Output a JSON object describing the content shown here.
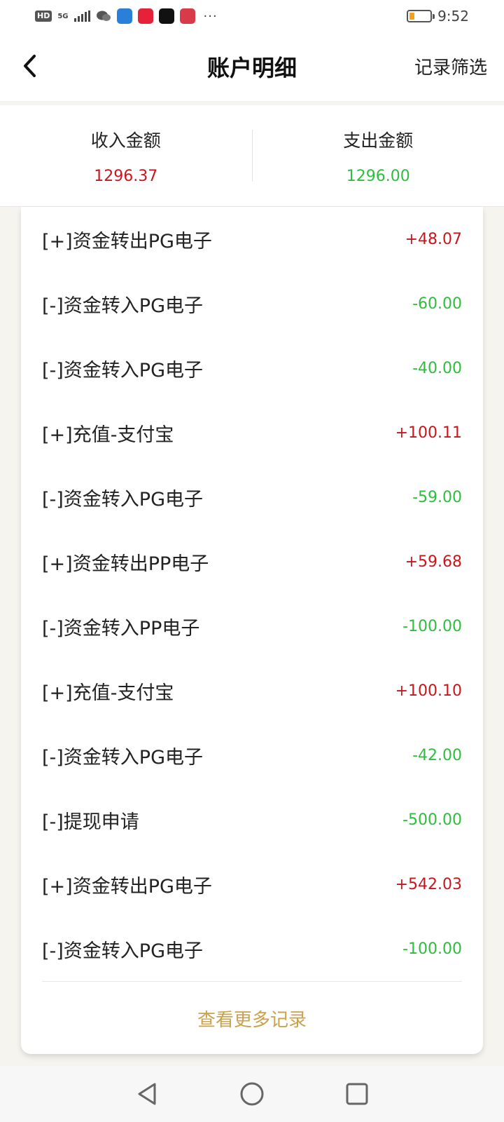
{
  "status_bar": {
    "left_badge": "HD",
    "network": "5G",
    "time": "9:52",
    "more": "···"
  },
  "header": {
    "title": "账户明细",
    "filter_label": "记录筛选"
  },
  "summary": {
    "income_label": "收入金额",
    "income_value": "1296.37",
    "expense_label": "支出金额",
    "expense_value": "1296.00"
  },
  "records": [
    {
      "label": "[+]资金转出PG电子",
      "amount": "+48.07",
      "type": "in"
    },
    {
      "label": "[-]资金转入PG电子",
      "amount": "-60.00",
      "type": "out"
    },
    {
      "label": "[-]资金转入PG电子",
      "amount": "-40.00",
      "type": "out"
    },
    {
      "label": "[+]充值-支付宝",
      "amount": "+100.11",
      "type": "in"
    },
    {
      "label": "[-]资金转入PG电子",
      "amount": "-59.00",
      "type": "out"
    },
    {
      "label": "[+]资金转出PP电子",
      "amount": "+59.68",
      "type": "in"
    },
    {
      "label": "[-]资金转入PP电子",
      "amount": "-100.00",
      "type": "out"
    },
    {
      "label": "[+]充值-支付宝",
      "amount": "+100.10",
      "type": "in"
    },
    {
      "label": "[-]资金转入PG电子",
      "amount": "-42.00",
      "type": "out"
    },
    {
      "label": "[-]提现申请",
      "amount": "-500.00",
      "type": "out"
    },
    {
      "label": "[+]资金转出PG电子",
      "amount": "+542.03",
      "type": "in"
    },
    {
      "label": "[-]资金转入PG电子",
      "amount": "-100.00",
      "type": "out"
    }
  ],
  "more_label": "查看更多记录",
  "colors": {
    "income": "#c8161d",
    "expense": "#2ebd3e",
    "accent": "#c9a24a"
  },
  "icons": {
    "back": "chevron-left-icon",
    "nav_back": "triangle-back-icon",
    "nav_home": "circle-home-icon",
    "nav_recent": "square-recent-icon"
  }
}
